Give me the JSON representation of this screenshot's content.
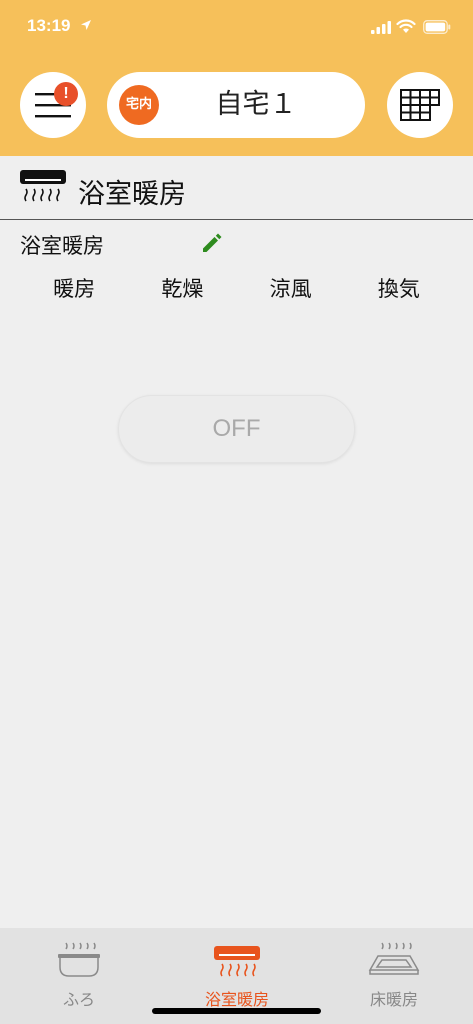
{
  "status_bar": {
    "time": "13:19",
    "icons": [
      "location-arrow-icon",
      "signal-bars-icon",
      "wifi-icon",
      "battery-icon"
    ]
  },
  "header": {
    "menu_icon": "hamburger-menu-icon",
    "alert_badge": "!",
    "home_tag": "宅内",
    "home_name": "自宅１",
    "grid_icon": "grid-icon",
    "background_color": "#f6c05a",
    "accent_color": "#ef6a21"
  },
  "device": {
    "icon": "bathroom-heater-icon",
    "title": "浴室暖房",
    "name": "浴室暖房",
    "edit_icon": "pencil-icon",
    "edit_icon_color": "#2e8b1e",
    "modes": [
      "暖房",
      "乾燥",
      "涼風",
      "換気"
    ],
    "power_label": "OFF"
  },
  "tabbar": {
    "tabs": [
      {
        "label": "ふろ",
        "icon": "bath-tub-icon",
        "active": false
      },
      {
        "label": "浴室暖房",
        "icon": "bathroom-heater-icon",
        "active": true
      },
      {
        "label": "床暖房",
        "icon": "floor-heating-icon",
        "active": false
      }
    ],
    "active_color": "#e8541d"
  }
}
